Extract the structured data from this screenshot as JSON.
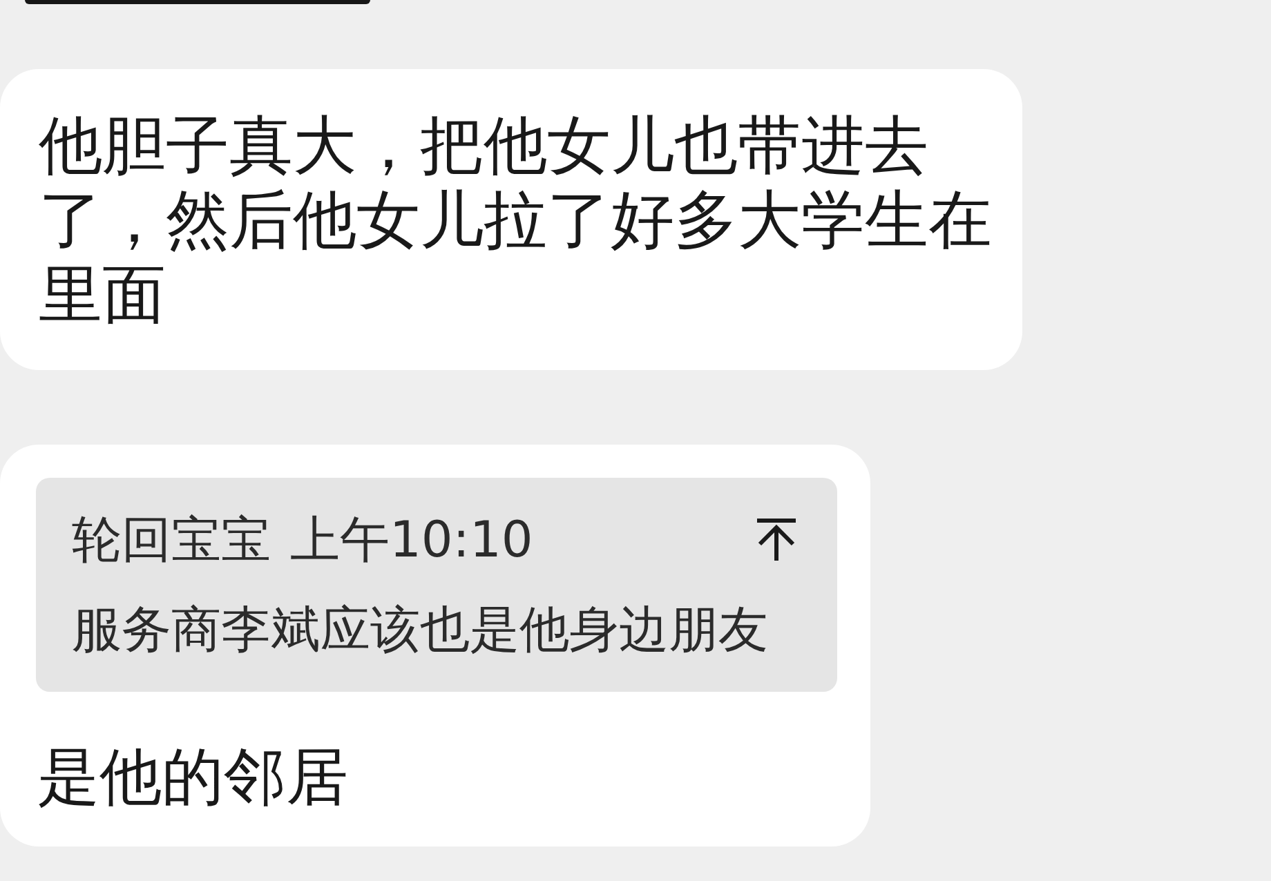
{
  "messages": [
    {
      "kind": "text",
      "text": "他胆子真大，把他女儿也带进去了，然后他女儿拉了好多大学生在里面"
    },
    {
      "kind": "reply",
      "quote": {
        "sender": "轮回宝宝",
        "time": "上午10:10",
        "text": "服务商李斌应该也是他身边朋友"
      },
      "text": "是他的邻居"
    }
  ]
}
